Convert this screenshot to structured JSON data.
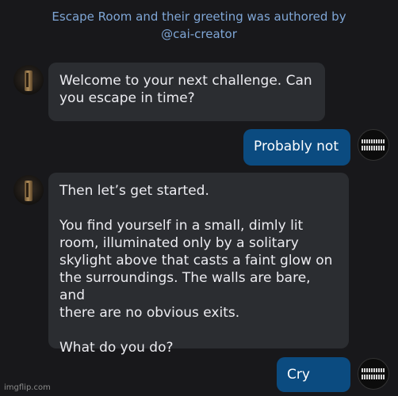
{
  "header": {
    "line1": "Escape Room and their greeting was authored by",
    "line2": "@cai-creator"
  },
  "messages": [
    {
      "role": "bot",
      "text": "Welcome to your next challenge. Can\nyou escape in time?"
    },
    {
      "role": "user",
      "text": "Probably not"
    },
    {
      "role": "bot",
      "text": "Then let’s get started.\n\nYou find yourself in a small, dimly lit\nroom, illuminated only by a solitary\nskylight above that casts a faint glow on\nthe surroundings. The walls are bare, and\nthere are no obvious exits.\n\nWhat do you do?"
    },
    {
      "role": "user",
      "text": "Cry"
    }
  ],
  "watermark": "imgflip.com"
}
